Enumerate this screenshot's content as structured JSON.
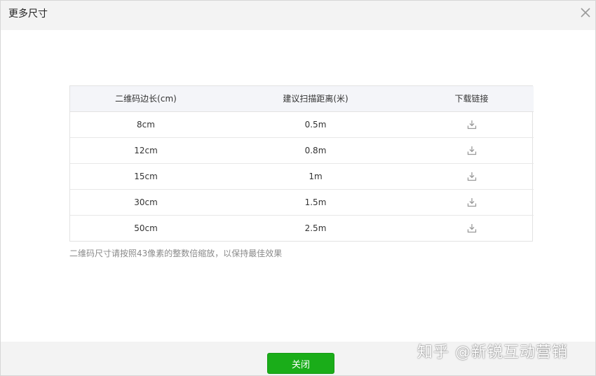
{
  "dialog": {
    "title": "更多尺寸",
    "close_icon": "close-icon"
  },
  "table": {
    "headers": [
      "二维码边长(cm)",
      "建议扫描距离(米)",
      "下载链接"
    ],
    "rows": [
      {
        "side": "8cm",
        "distance": "0.5m",
        "icon": "download-icon"
      },
      {
        "side": "12cm",
        "distance": "0.8m",
        "icon": "download-icon"
      },
      {
        "side": "15cm",
        "distance": "1m",
        "icon": "download-icon"
      },
      {
        "side": "30cm",
        "distance": "1.5m",
        "icon": "download-icon"
      },
      {
        "side": "50cm",
        "distance": "2.5m",
        "icon": "download-icon"
      }
    ]
  },
  "note": "二维码尺寸请按照43像素的整数倍缩放，以保持最佳效果",
  "footer": {
    "close_label": "关闭"
  },
  "watermark": "知乎 @新锐互动营销",
  "colors": {
    "primary_button": "#1aad19",
    "header_bg": "#f3f3f3",
    "table_header_bg": "#f4f5f9"
  }
}
